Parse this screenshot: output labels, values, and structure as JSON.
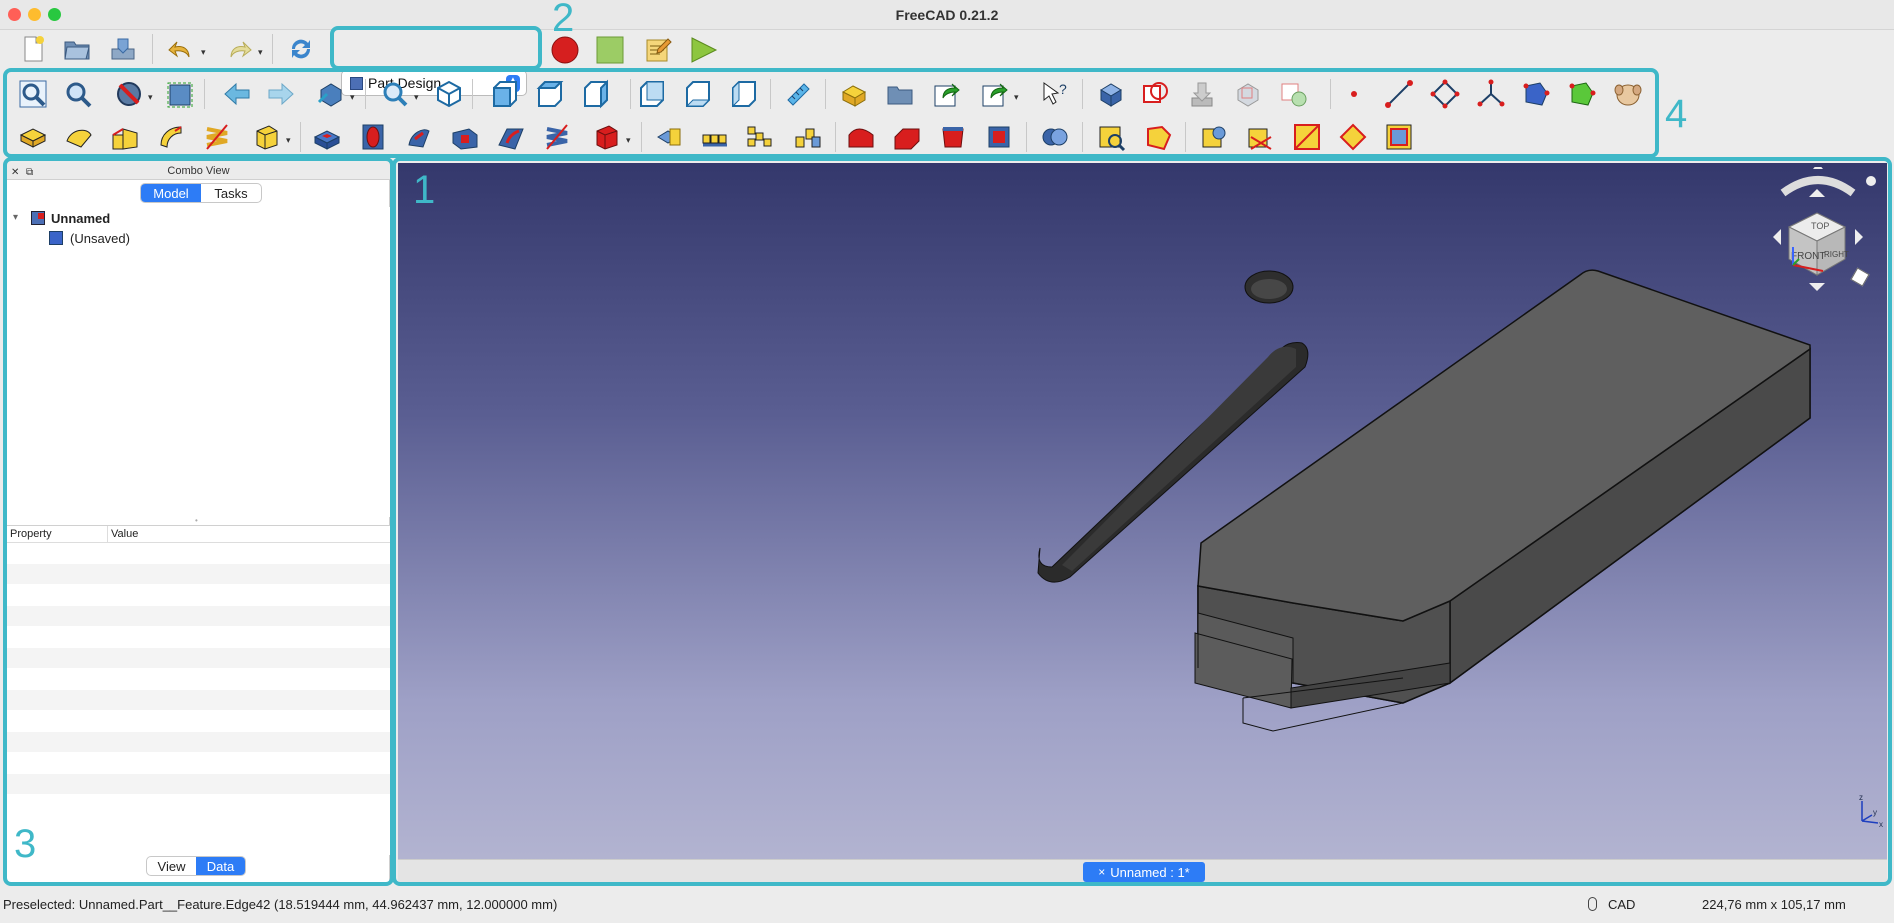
{
  "window": {
    "title": "FreeCAD 0.21.2"
  },
  "traffic_lights": {
    "close": "#ff5f57",
    "minimize": "#febc2e",
    "zoom": "#28c840"
  },
  "workbench": {
    "selected": "Part Design"
  },
  "combo_view": {
    "title": "Combo View",
    "tabs": [
      "Model",
      "Tasks"
    ],
    "active_tab": "Model",
    "tree": {
      "root": "Unnamed",
      "child": "(Unsaved)"
    },
    "property_headers": [
      "Property",
      "Value"
    ],
    "bottom_tabs": [
      "View",
      "Data"
    ],
    "active_bottom_tab": "Data"
  },
  "viewport": {
    "doc_tab": "Unnamed : 1*",
    "doc_tab_close": "×"
  },
  "navcube": {
    "top": "TOP",
    "front": "FRONT",
    "right": "RIGHT"
  },
  "axis_labels": {
    "z": "z",
    "y": "y",
    "x": "x"
  },
  "status": {
    "message": "Preselected: Unnamed.Part__Feature.Edge42 (18.519444 mm, 44.962437 mm, 12.000000 mm)",
    "nav_style": "CAD",
    "dimensions": "224,76 mm x 105,17 mm"
  },
  "annotations": [
    "1",
    "2",
    "3",
    "4"
  ],
  "accent_color": "#3fb8c8",
  "selection_blue": "#2d7cf6"
}
